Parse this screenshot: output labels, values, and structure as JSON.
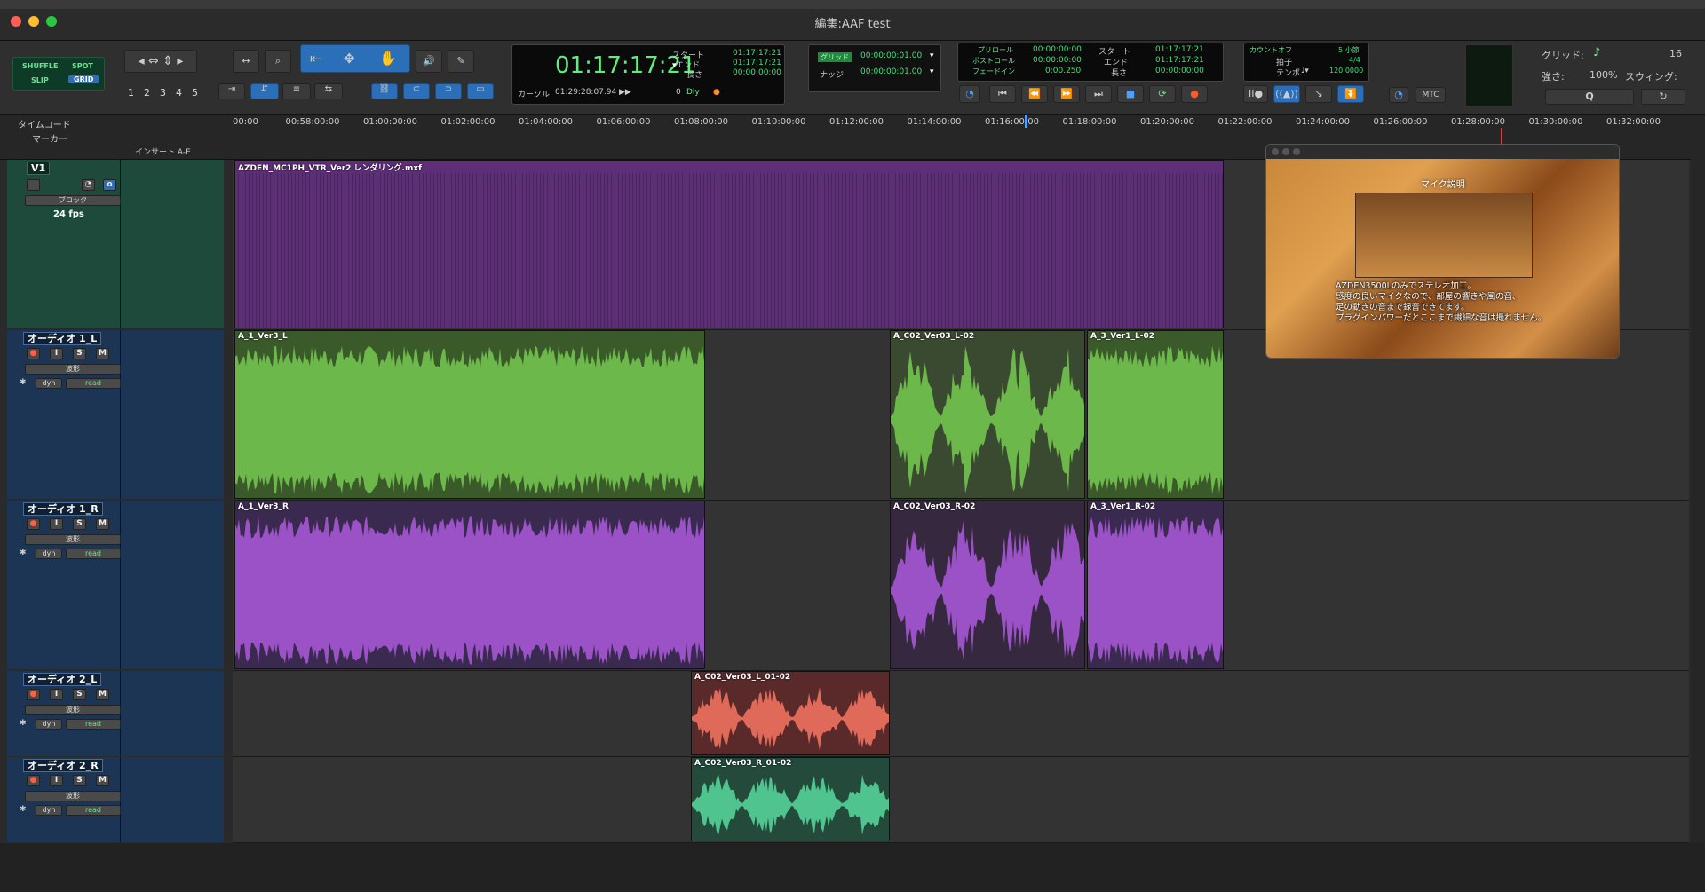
{
  "window": {
    "title": "編集:AAF test"
  },
  "edit_modes": {
    "shuffle": "SHUFFLE",
    "spot": "SPOT",
    "slip": "SLIP",
    "grid": "GRID"
  },
  "zoom_presets": [
    "1",
    "2",
    "3",
    "4",
    "5"
  ],
  "main_counter": {
    "time": "01:17:17:21",
    "start_label": "スタート",
    "start": "01:17:17:21",
    "end_label": "エンド",
    "end": "01:17:17:21",
    "length_label": "長さ",
    "length": "00:00:00:00",
    "cursor_label": "カーソル",
    "cursor": "01:29:28:07.94",
    "cursor_value": "0",
    "dly": "Dly"
  },
  "grid_nudge": {
    "grid_label": "グリッド",
    "grid_value": "00:00:00:01.00",
    "nudge_label": "ナッジ",
    "nudge_value": "00:00:00:01.00"
  },
  "transport_counter": {
    "preroll_label": "プリロール",
    "preroll": "00:00:00:00",
    "postroll_label": "ポストロール",
    "postroll": "00:00:00:00",
    "fadein_label": "フェードイン",
    "fadein": "0:00.250",
    "start_label": "スタート",
    "start": "01:17:17:21",
    "end_label": "エンド",
    "end": "01:17:17:21",
    "length_label": "長さ",
    "length": "00:00:00:00"
  },
  "midi": {
    "countoff_label": "カウントオフ",
    "countoff": "5 小節",
    "meter_label": "拍子",
    "meter": "4/4",
    "tempo_label": "テンポ",
    "tempo": "120.0000",
    "mtc": "MTC"
  },
  "grid_panel": {
    "grid_label": "グリッド:",
    "grid_value": "16",
    "strength_label": "強さ:",
    "strength": "100%",
    "swing_label": "スウィング:",
    "q_label": "Q"
  },
  "rulers": {
    "timecode_label": "タイムコード",
    "marker_label": "マーカー",
    "insert_label": "インサート A-E",
    "ticks": [
      "00:00",
      "00:58:00:00",
      "01:00:00:00",
      "01:02:00:00",
      "01:04:00:00",
      "01:06:00:00",
      "01:08:00:00",
      "01:10:00:00",
      "01:12:00:00",
      "01:14:00:00",
      "01:16:00:00",
      "01:18:00:00",
      "01:20:00:00",
      "01:22:00:00",
      "01:24:00:00",
      "01:26:00:00",
      "01:28:00:00",
      "01:30:00:00",
      "01:32:00:00"
    ]
  },
  "tracks": [
    {
      "name": "V1",
      "mode": "ブロック",
      "fps": "24 fps",
      "type": "video"
    },
    {
      "name": "オーディオ 1_L",
      "view": "波形",
      "auto": "dyn",
      "read": "read",
      "type": "audio"
    },
    {
      "name": "オーディオ 1_R",
      "view": "波形",
      "auto": "dyn",
      "read": "read",
      "type": "audio"
    },
    {
      "name": "オーディオ 2_L",
      "view": "波形",
      "auto": "dyn",
      "read": "read",
      "type": "audio"
    },
    {
      "name": "オーディオ 2_R",
      "view": "波形",
      "auto": "dyn",
      "read": "read",
      "type": "audio"
    }
  ],
  "track_buttons": {
    "input": "I",
    "solo": "S",
    "mute": "M"
  },
  "clips": {
    "video": "AZDEN_MC1PH_VTR_Ver2 レンダリング.mxf",
    "a1l_1": "A_1_Ver3_L",
    "a1l_2": "A_C02_Ver03_L-02",
    "a1l_3": "A_3_Ver1_L-02",
    "a1r_1": "A_1_Ver3_R",
    "a1r_2": "A_C02_Ver03_R-02",
    "a1r_3": "A_3_Ver1_R-02",
    "a2l_1": "A_C02_Ver03_L_01-02",
    "a2r_1": "A_C02_Ver03_R_01-02"
  },
  "video_window": {
    "caption_top": "マイク説明",
    "caption_lines": [
      "AZDEN3500Lのみでステレオ加工。",
      "感度の良いマイクなので、部屋の響きや風の音、",
      "足の動きの音まで録音できてます。",
      "プラグインパワーだとここまで繊細な音は撮れません。"
    ]
  },
  "colors": {
    "video_clip": "#5e2f78",
    "audio1_l": "#6db84a",
    "audio1_r": "#9a52c6",
    "audio2_l": "#e06a5a",
    "audio2_r": "#4fc48f",
    "dim_clip": "#4a5a42"
  }
}
